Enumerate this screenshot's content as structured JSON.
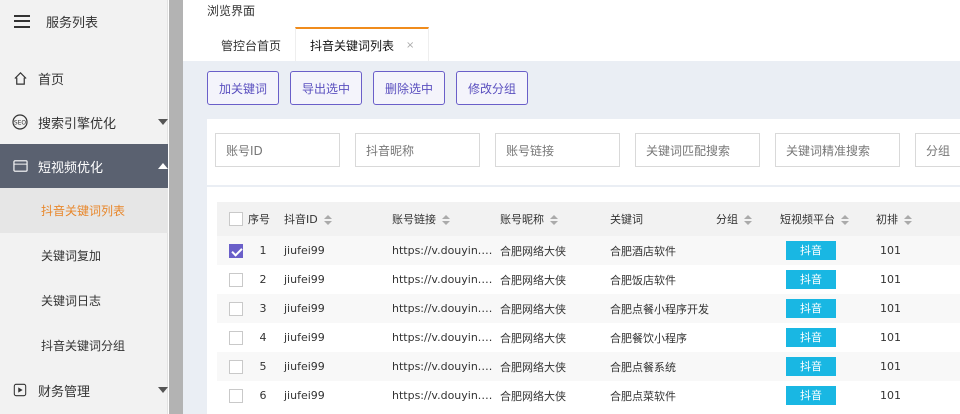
{
  "sidebar": {
    "title": "服务列表",
    "items": [
      {
        "label": "首页"
      },
      {
        "label": "搜索引擎优化"
      },
      {
        "label": "短视频优化"
      },
      {
        "label": "财务管理"
      }
    ],
    "subitems": [
      {
        "label": "抖音关键词列表"
      },
      {
        "label": "关键词复加"
      },
      {
        "label": "关键词日志"
      },
      {
        "label": "抖音关键词分组"
      }
    ]
  },
  "breadcrumb": "浏览界面",
  "tabs": [
    {
      "label": "管控台首页"
    },
    {
      "label": "抖音关键词列表",
      "close": "×"
    }
  ],
  "toolbar": {
    "add": "加关键词",
    "export": "导出选中",
    "delete": "删除选中",
    "group": "修改分组"
  },
  "filters": {
    "account_id": "账号ID",
    "nickname": "抖音昵称",
    "link": "账号链接",
    "keyword_fuzzy": "关键词匹配搜索",
    "keyword_exact": "关键词精准搜索",
    "group": "分组"
  },
  "table": {
    "headers": {
      "index": "序号",
      "douyin_id": "抖音ID",
      "link": "账号链接",
      "nickname": "账号昵称",
      "keyword": "关键词",
      "group": "分组",
      "platform": "短视频平台",
      "rank": "初排"
    },
    "rows": [
      {
        "index": "1",
        "douyin_id": "jiufei99",
        "link": "https://v.douyin.com/...",
        "nickname": "合肥网络大侠",
        "keyword": "合肥酒店软件",
        "platform": "抖音",
        "rank": "101",
        "checked": true
      },
      {
        "index": "2",
        "douyin_id": "jiufei99",
        "link": "https://v.douyin.com/...",
        "nickname": "合肥网络大侠",
        "keyword": "合肥饭店软件",
        "platform": "抖音",
        "rank": "101",
        "checked": false
      },
      {
        "index": "3",
        "douyin_id": "jiufei99",
        "link": "https://v.douyin.com/...",
        "nickname": "合肥网络大侠",
        "keyword": "合肥点餐小程序开发",
        "platform": "抖音",
        "rank": "101",
        "checked": false
      },
      {
        "index": "4",
        "douyin_id": "jiufei99",
        "link": "https://v.douyin.com/...",
        "nickname": "合肥网络大侠",
        "keyword": "合肥餐饮小程序",
        "platform": "抖音",
        "rank": "101",
        "checked": false
      },
      {
        "index": "5",
        "douyin_id": "jiufei99",
        "link": "https://v.douyin.com/...",
        "nickname": "合肥网络大侠",
        "keyword": "合肥点餐系统",
        "platform": "抖音",
        "rank": "101",
        "checked": false
      },
      {
        "index": "6",
        "douyin_id": "jiufei99",
        "link": "https://v.douyin.com/...",
        "nickname": "合肥网络大侠",
        "keyword": "合肥点菜软件",
        "platform": "抖音",
        "rank": "101",
        "checked": false
      }
    ]
  },
  "colors": {
    "accent": "#6a5fc9",
    "active_tab": "#f08c1c",
    "badge": "#19b7e3",
    "sidebar_active": "#5a6170"
  }
}
